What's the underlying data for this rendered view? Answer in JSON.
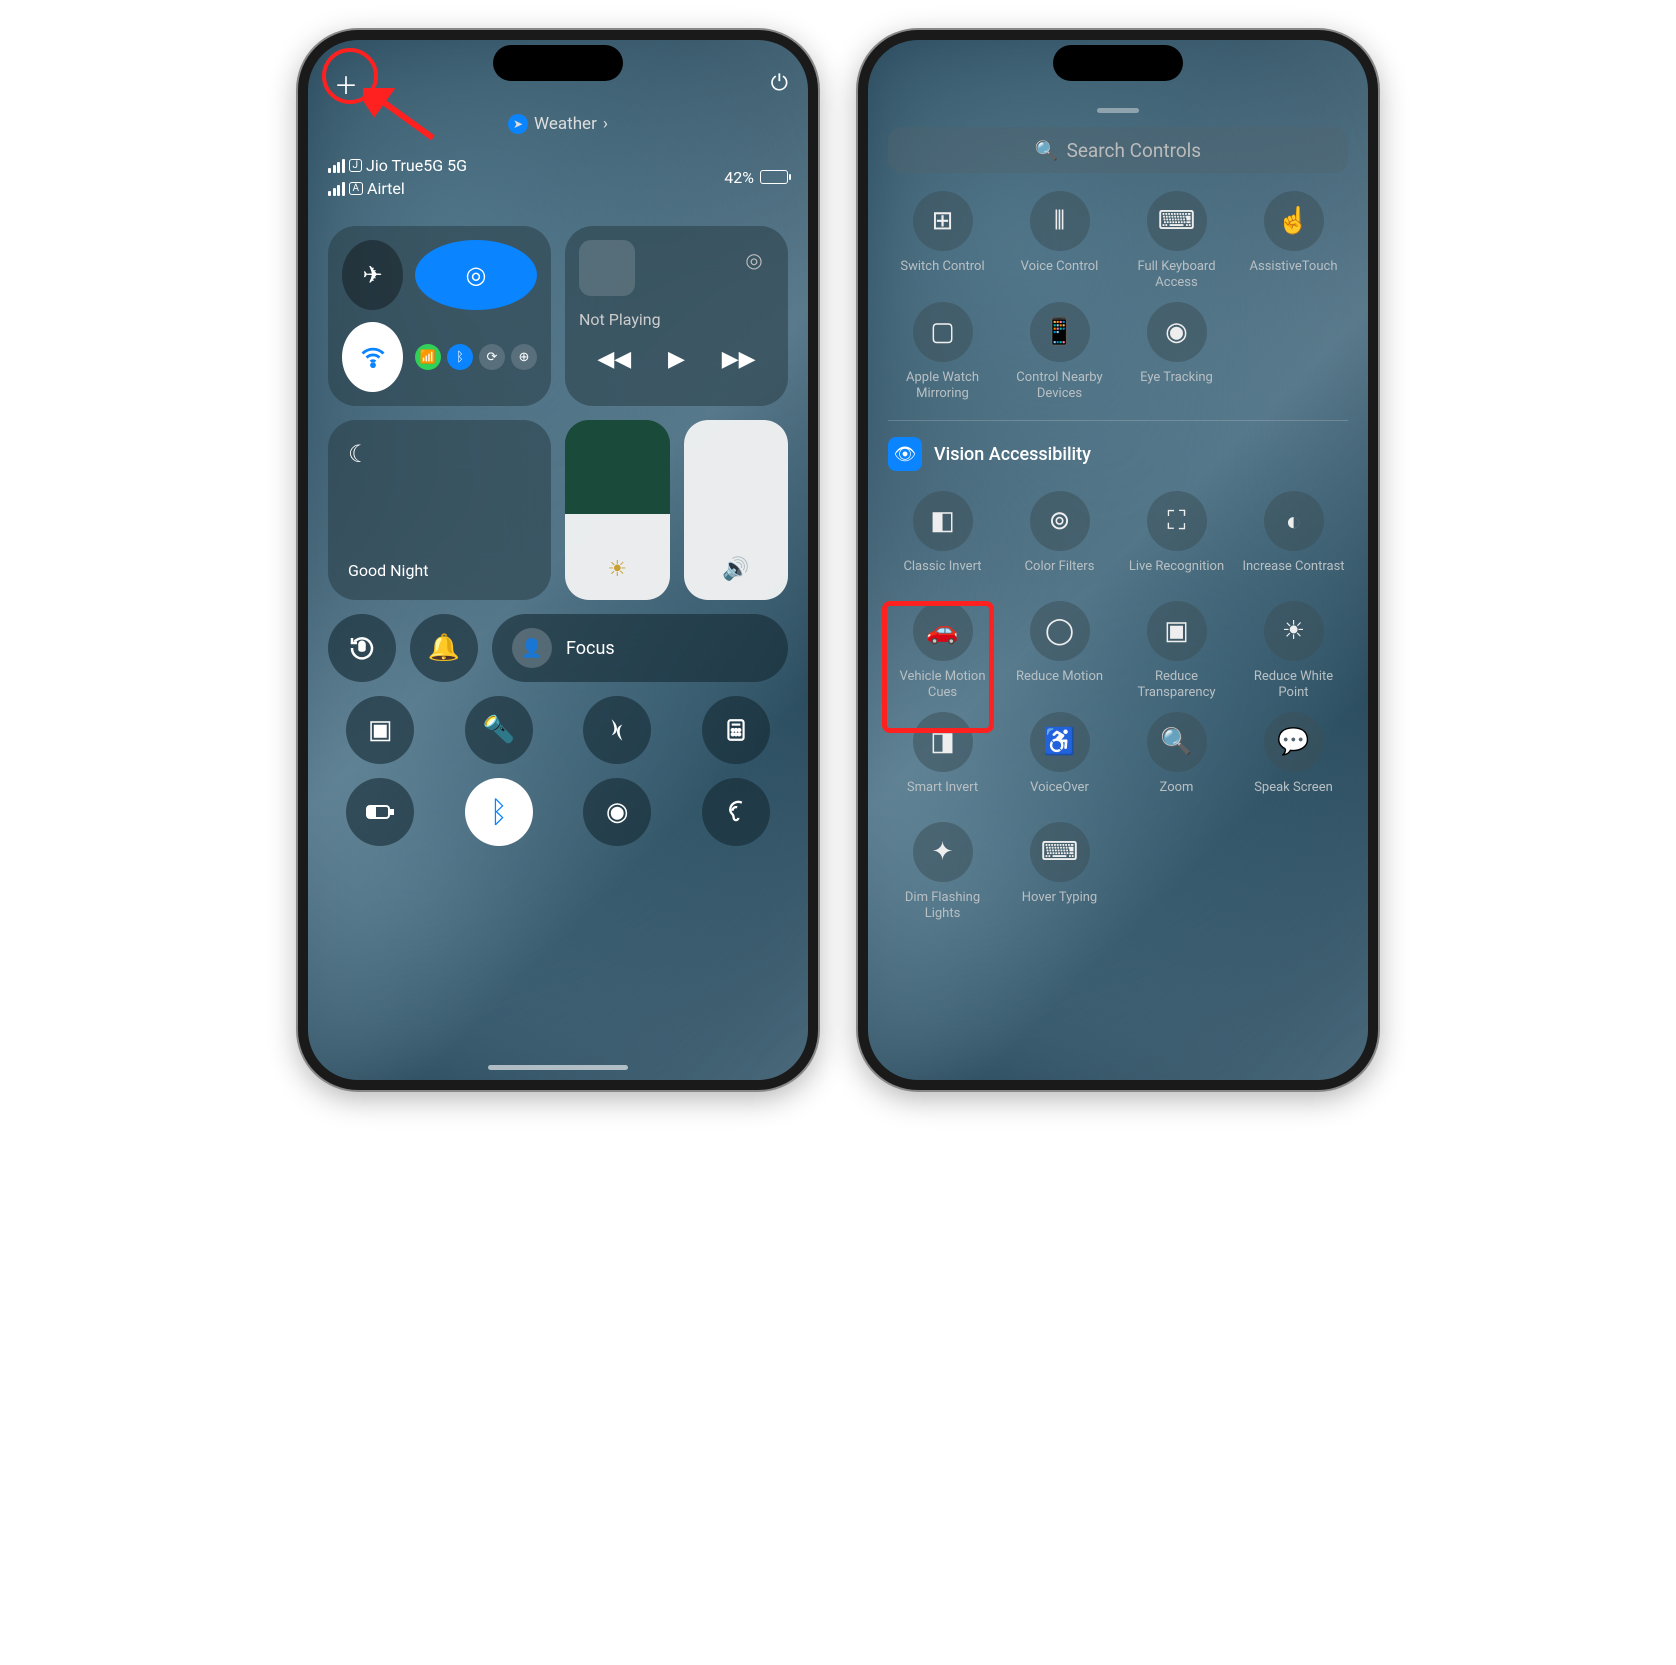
{
  "left": {
    "breadcrumb": {
      "app": "Weather"
    },
    "carriers": [
      {
        "sim": "J",
        "name": "Jio True5G 5G"
      },
      {
        "sim": "A",
        "name": "Airtel"
      }
    ],
    "battery_pct": "42%",
    "media": {
      "status": "Not Playing"
    },
    "focus_tile": {
      "label": "Good Night"
    },
    "focus_pill": {
      "label": "Focus"
    }
  },
  "right": {
    "search_placeholder": "Search Controls",
    "top_controls": [
      {
        "id": "switch-control",
        "label": "Switch Control",
        "glyph": "⊞"
      },
      {
        "id": "voice-control",
        "label": "Voice Control",
        "glyph": "⦀"
      },
      {
        "id": "full-keyboard-access",
        "label": "Full Keyboard Access",
        "glyph": "⌨"
      },
      {
        "id": "assistivetouch",
        "label": "AssistiveTouch",
        "glyph": "☝"
      },
      {
        "id": "apple-watch-mirroring",
        "label": "Apple Watch Mirroring",
        "glyph": "▢"
      },
      {
        "id": "control-nearby-devices",
        "label": "Control Nearby Devices",
        "glyph": "📱"
      },
      {
        "id": "eye-tracking",
        "label": "Eye Tracking",
        "glyph": "◉"
      }
    ],
    "vision_section": {
      "title": "Vision Accessibility"
    },
    "vision_controls": [
      {
        "id": "classic-invert",
        "label": "Classic Invert",
        "glyph": "◧"
      },
      {
        "id": "color-filters",
        "label": "Color Filters",
        "glyph": "⊚"
      },
      {
        "id": "live-recognition",
        "label": "Live Recognition",
        "glyph": "⛶"
      },
      {
        "id": "increase-contrast",
        "label": "Increase Contrast",
        "glyph": "◐"
      },
      {
        "id": "vehicle-motion-cues",
        "label": "Vehicle Motion Cues",
        "glyph": "🚗"
      },
      {
        "id": "reduce-motion",
        "label": "Reduce Motion",
        "glyph": "◯"
      },
      {
        "id": "reduce-transparency",
        "label": "Reduce Transparency",
        "glyph": "▣"
      },
      {
        "id": "reduce-white-point",
        "label": "Reduce White Point",
        "glyph": "☀"
      },
      {
        "id": "smart-invert",
        "label": "Smart Invert",
        "glyph": "◨"
      },
      {
        "id": "voiceover",
        "label": "VoiceOver",
        "glyph": "♿"
      },
      {
        "id": "zoom",
        "label": "Zoom",
        "glyph": "🔍"
      },
      {
        "id": "speak-screen",
        "label": "Speak Screen",
        "glyph": "💬"
      },
      {
        "id": "dim-flashing-lights",
        "label": "Dim Flashing Lights",
        "glyph": "✦"
      },
      {
        "id": "hover-typing",
        "label": "Hover Typing",
        "glyph": "⌨"
      }
    ]
  }
}
